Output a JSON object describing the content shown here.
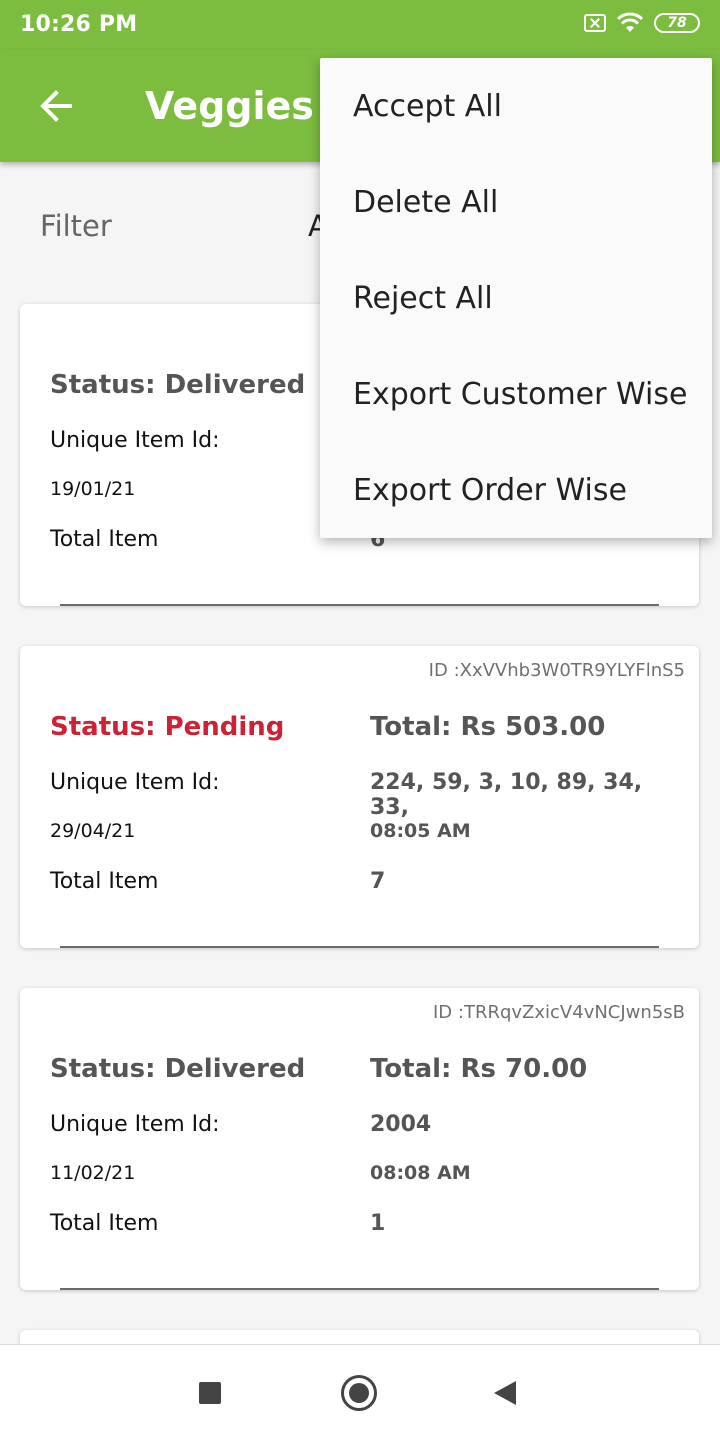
{
  "status_bar": {
    "time": "10:26 PM",
    "battery": "78"
  },
  "app_bar": {
    "title": "Veggies A"
  },
  "filter": {
    "label": "Filter",
    "value": "A"
  },
  "menu": {
    "items": [
      "Accept All",
      "Delete All",
      "Reject All",
      "Export Customer Wise",
      "Export Order Wise"
    ]
  },
  "orders": [
    {
      "id": "",
      "status": "Status: Delivered",
      "total": "",
      "unique_label": "Unique Item Id:",
      "unique_ids": "",
      "date": "19/01/21",
      "time": "",
      "total_item_label": "Total Item",
      "total_items": "6"
    },
    {
      "id": "ID :XxVVhb3W0TR9YLYFlnS5",
      "status": "Status: Pending",
      "total": "Total: Rs 503.00",
      "unique_label": "Unique Item Id:",
      "unique_ids": "224, 59, 3, 10, 89, 34, 33,",
      "date": "29/04/21",
      "time": "08:05 AM",
      "total_item_label": "Total Item",
      "total_items": "7"
    },
    {
      "id": "ID :TRRqvZxicV4vNCJwn5sB",
      "status": "Status: Delivered",
      "total": "Total: Rs 70.00",
      "unique_label": "Unique Item Id:",
      "unique_ids": "2004",
      "date": "11/02/21",
      "time": "08:08 AM",
      "total_item_label": "Total Item",
      "total_items": "1"
    }
  ],
  "colors": {
    "primary": "#7cbd3f",
    "pending": "#cc2233"
  }
}
